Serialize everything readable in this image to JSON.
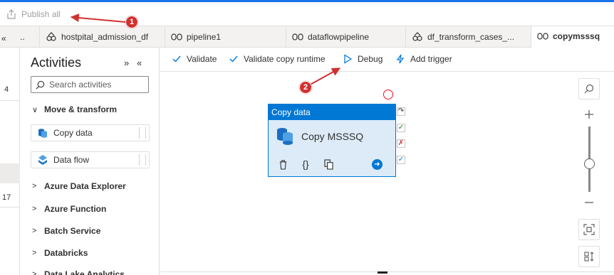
{
  "topbar": {
    "publish_label": "Publish all"
  },
  "tabs": [
    {
      "label": "..",
      "icon": "pipeline-icon"
    },
    {
      "label": "hostpital_admission_df",
      "icon": "dataflow-icon"
    },
    {
      "label": "pipeline1",
      "icon": "pipeline-icon"
    },
    {
      "label": "dataflowpipeline",
      "icon": "pipeline-icon"
    },
    {
      "label": "df_transform_cases_...",
      "icon": "dataflow-icon"
    },
    {
      "label": "copymsssq",
      "icon": "pipeline-icon",
      "active": true
    }
  ],
  "left_rail": {
    "top_chevron": "«",
    "count_a": "4",
    "count_b": "17"
  },
  "activities": {
    "title": "Activities",
    "collapse_all": "»",
    "hide_panel": "«",
    "search_placeholder": "Search activities",
    "groups": {
      "move_transform": "Move & transform",
      "azure_data_explorer": "Azure Data Explorer",
      "azure_function": "Azure Function",
      "batch_service": "Batch Service",
      "databricks": "Databricks",
      "data_lake_analytics": "Data Lake Analytics"
    },
    "items": {
      "copy_data": "Copy data",
      "data_flow": "Data flow"
    }
  },
  "toolbar": {
    "validate": "Validate",
    "validate_copy_runtime": "Validate copy runtime",
    "debug": "Debug",
    "add_trigger": "Add trigger"
  },
  "node": {
    "type_label": "Copy data",
    "name": "Copy MSSSQ"
  },
  "annotations": {
    "badge1": "1",
    "badge2": "2"
  },
  "colors": {
    "accent": "#0078d4",
    "node_bg": "#dcebf7",
    "annotation": "#d32f2f"
  }
}
